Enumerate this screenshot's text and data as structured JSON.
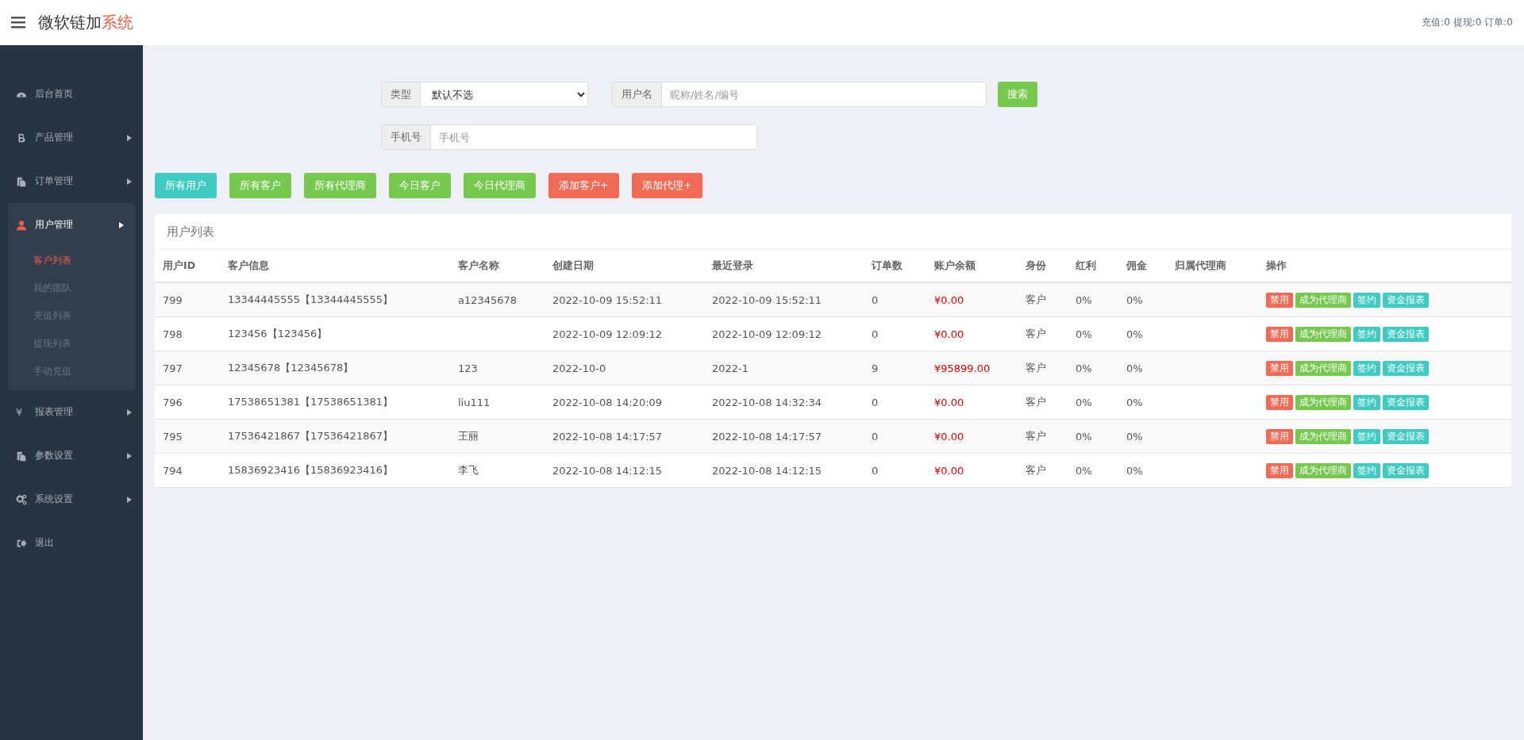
{
  "header": {
    "title": "微软链加",
    "title_accent": "系统",
    "stats": "充值:0 提现:0 订单:0"
  },
  "sidebar": {
    "items": [
      {
        "label": "后台首页",
        "has_submenu": false,
        "selected": false,
        "expanded": false
      },
      {
        "label": "产品管理",
        "has_submenu": true,
        "selected": false,
        "expanded": false
      },
      {
        "label": "订单管理",
        "has_submenu": true,
        "selected": false,
        "expanded": false
      },
      {
        "label": "用户管理",
        "has_submenu": true,
        "selected": true,
        "expanded": true,
        "children": [
          {
            "label": "客户列表",
            "selected": true
          },
          {
            "label": "我的团队",
            "selected": false
          },
          {
            "label": "充值列表",
            "selected": false
          },
          {
            "label": "提现列表",
            "selected": false
          },
          {
            "label": "手动充值",
            "selected": false
          }
        ]
      },
      {
        "label": "报表管理",
        "icon_char": "¥",
        "has_submenu": true,
        "selected": false,
        "expanded": false
      },
      {
        "label": "参数设置",
        "has_submenu": true,
        "selected": false,
        "expanded": false
      },
      {
        "label": "系统设置",
        "has_submenu": true,
        "selected": false,
        "expanded": false
      },
      {
        "label": "退出",
        "has_submenu": false,
        "selected": false,
        "expanded": false
      }
    ]
  },
  "filters": {
    "type": {
      "label": "类型",
      "value": "默认不选"
    },
    "username": {
      "label": "用户名",
      "placeholder": "昵称/姓名/编号"
    },
    "search_button": "搜索",
    "phone": {
      "label": "手机号",
      "placeholder": "手机号"
    }
  },
  "quick_buttons": [
    {
      "label": "所有用户",
      "kind": "info"
    },
    {
      "label": "所有客户",
      "kind": "success"
    },
    {
      "label": "所有代理商",
      "kind": "success"
    },
    {
      "label": "今日客户",
      "kind": "success"
    },
    {
      "label": "今日代理商",
      "kind": "success"
    },
    {
      "label": "添加客户+",
      "kind": "danger"
    },
    {
      "label": "添加代理+",
      "kind": "danger"
    }
  ],
  "table": {
    "title": "用户列表",
    "columns": [
      "用户ID",
      "客户信息",
      "客户名称",
      "创建日期",
      "最近登录",
      "订单数",
      "账户余额",
      "身份",
      "红利",
      "佣金",
      "归属代理商",
      "操作"
    ],
    "rows": [
      {
        "id": "799",
        "info": "13344445555【13344445555】",
        "name": "a12345678",
        "created": "2022-10-09 15:52:11",
        "last_login": "2022-10-09 15:52:11",
        "orders": "0",
        "balance": "¥0.00",
        "role": "客户",
        "bonus": "0%",
        "commission": "0%",
        "actions": [
          {
            "label": "禁用",
            "kind": "danger"
          },
          {
            "label": "成为代理商",
            "kind": "success"
          },
          {
            "label": "签约",
            "kind": "info"
          },
          {
            "label": "资金报表",
            "kind": "info"
          }
        ]
      },
      {
        "id": "798",
        "info": "123456【123456】",
        "created": "2022-10-09 12:09:12",
        "last_login": "2022-10-09 12:09:12",
        "orders": "0",
        "balance": "¥0.00",
        "role": "客户",
        "bonus": "0%",
        "commission": "0%",
        "actions": [
          {
            "label": "禁用",
            "kind": "danger"
          },
          {
            "label": "成为代理商",
            "kind": "success"
          },
          {
            "label": "签约",
            "kind": "info"
          },
          {
            "label": "资金报表",
            "kind": "info"
          }
        ]
      },
      {
        "id": "797",
        "info": "12345678【12345678】",
        "name": "123",
        "created": "2022-10-0",
        "last_login": "2022-1",
        "orders": "9",
        "balance": "¥95899.00",
        "role": "客户",
        "bonus": "0%",
        "commission": "0%",
        "actions": [
          {
            "label": "禁用",
            "kind": "danger"
          },
          {
            "label": "成为代理商",
            "kind": "success"
          },
          {
            "label": "签约",
            "kind": "info"
          },
          {
            "label": "资金报表",
            "kind": "info"
          }
        ]
      },
      {
        "id": "796",
        "info": "17538651381【17538651381】",
        "name": "liu111",
        "created": "2022-10-08 14:20:09",
        "last_login": "2022-10-08 14:32:34",
        "orders": "0",
        "balance": "¥0.00",
        "role": "客户",
        "bonus": "0%",
        "commission": "0%",
        "actions": [
          {
            "label": "禁用",
            "kind": "danger"
          },
          {
            "label": "成为代理商",
            "kind": "success"
          },
          {
            "label": "签约",
            "kind": "info"
          },
          {
            "label": "资金报表",
            "kind": "info"
          }
        ]
      },
      {
        "id": "795",
        "info": "17536421867【17536421867】",
        "name": "王丽",
        "created": "2022-10-08 14:17:57",
        "last_login": "2022-10-08 14:17:57",
        "orders": "0",
        "balance": "¥0.00",
        "role": "客户",
        "bonus": "0%",
        "commission": "0%",
        "actions": [
          {
            "label": "禁用",
            "kind": "danger"
          },
          {
            "label": "成为代理商",
            "kind": "success"
          },
          {
            "label": "签约",
            "kind": "info"
          },
          {
            "label": "资金报表",
            "kind": "info"
          }
        ]
      },
      {
        "id": "794",
        "info": "15836923416【15836923416】",
        "name": "李飞",
        "created": "2022-10-08 14:12:15",
        "last_login": "2022-10-08 14:12:15",
        "orders": "0",
        "balance": "¥0.00",
        "role": "客户",
        "bonus": "0%",
        "commission": "0%",
        "actions": [
          {
            "label": "禁用",
            "kind": "danger"
          },
          {
            "label": "成为代理商",
            "kind": "success"
          },
          {
            "label": "签约",
            "kind": "info"
          },
          {
            "label": "资金报表",
            "kind": "info"
          }
        ]
      }
    ]
  }
}
